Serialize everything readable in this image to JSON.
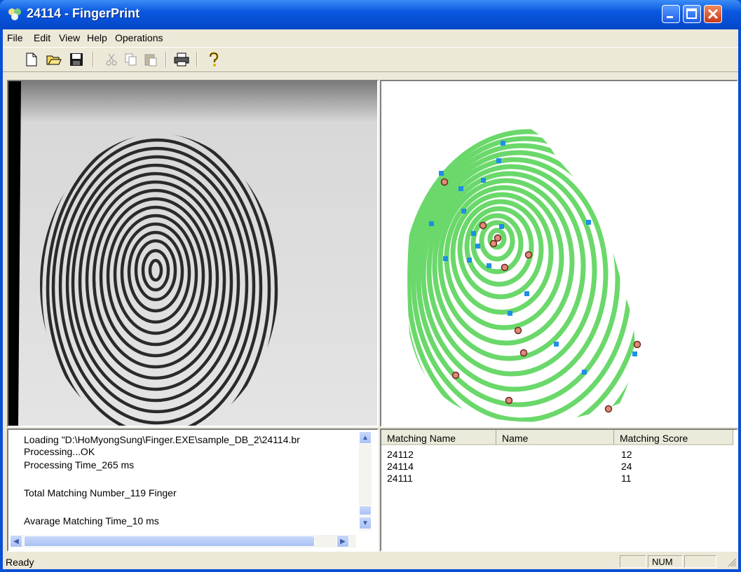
{
  "window": {
    "title": "24114 - FingerPrint"
  },
  "menu": [
    "File",
    "Edit",
    "View",
    "Help",
    "Operations"
  ],
  "toolbar_icons": [
    "new-file-icon",
    "open-folder-icon",
    "save-icon",
    "cut-icon",
    "copy-icon",
    "paste-icon",
    "print-icon",
    "help-icon"
  ],
  "log": {
    "lines": [
      "Loading \"D:\\HoMyongSung\\Finger.EXE\\sample_DB_2\\24114.br",
      "Processing...OK",
      "Processing Time_265 ms",
      "",
      "Total Matching Number_119 Finger",
      "",
      "Avarage Matching Time_10 ms"
    ]
  },
  "results": {
    "columns": [
      "Matching Name",
      "Name",
      "Matching Score"
    ],
    "rows": [
      {
        "matching_name": "24112",
        "name": "",
        "score": "12"
      },
      {
        "matching_name": "24114",
        "name": "",
        "score": "24"
      },
      {
        "matching_name": "24111",
        "name": "",
        "score": "11"
      }
    ]
  },
  "status": {
    "text": "Ready",
    "num": "NUM"
  },
  "colors": {
    "ridge": "#6ad86a",
    "minutia_end": "#e08a78",
    "minutia_bif": "#1e8ee8",
    "titlebar": "#0a58e0"
  }
}
